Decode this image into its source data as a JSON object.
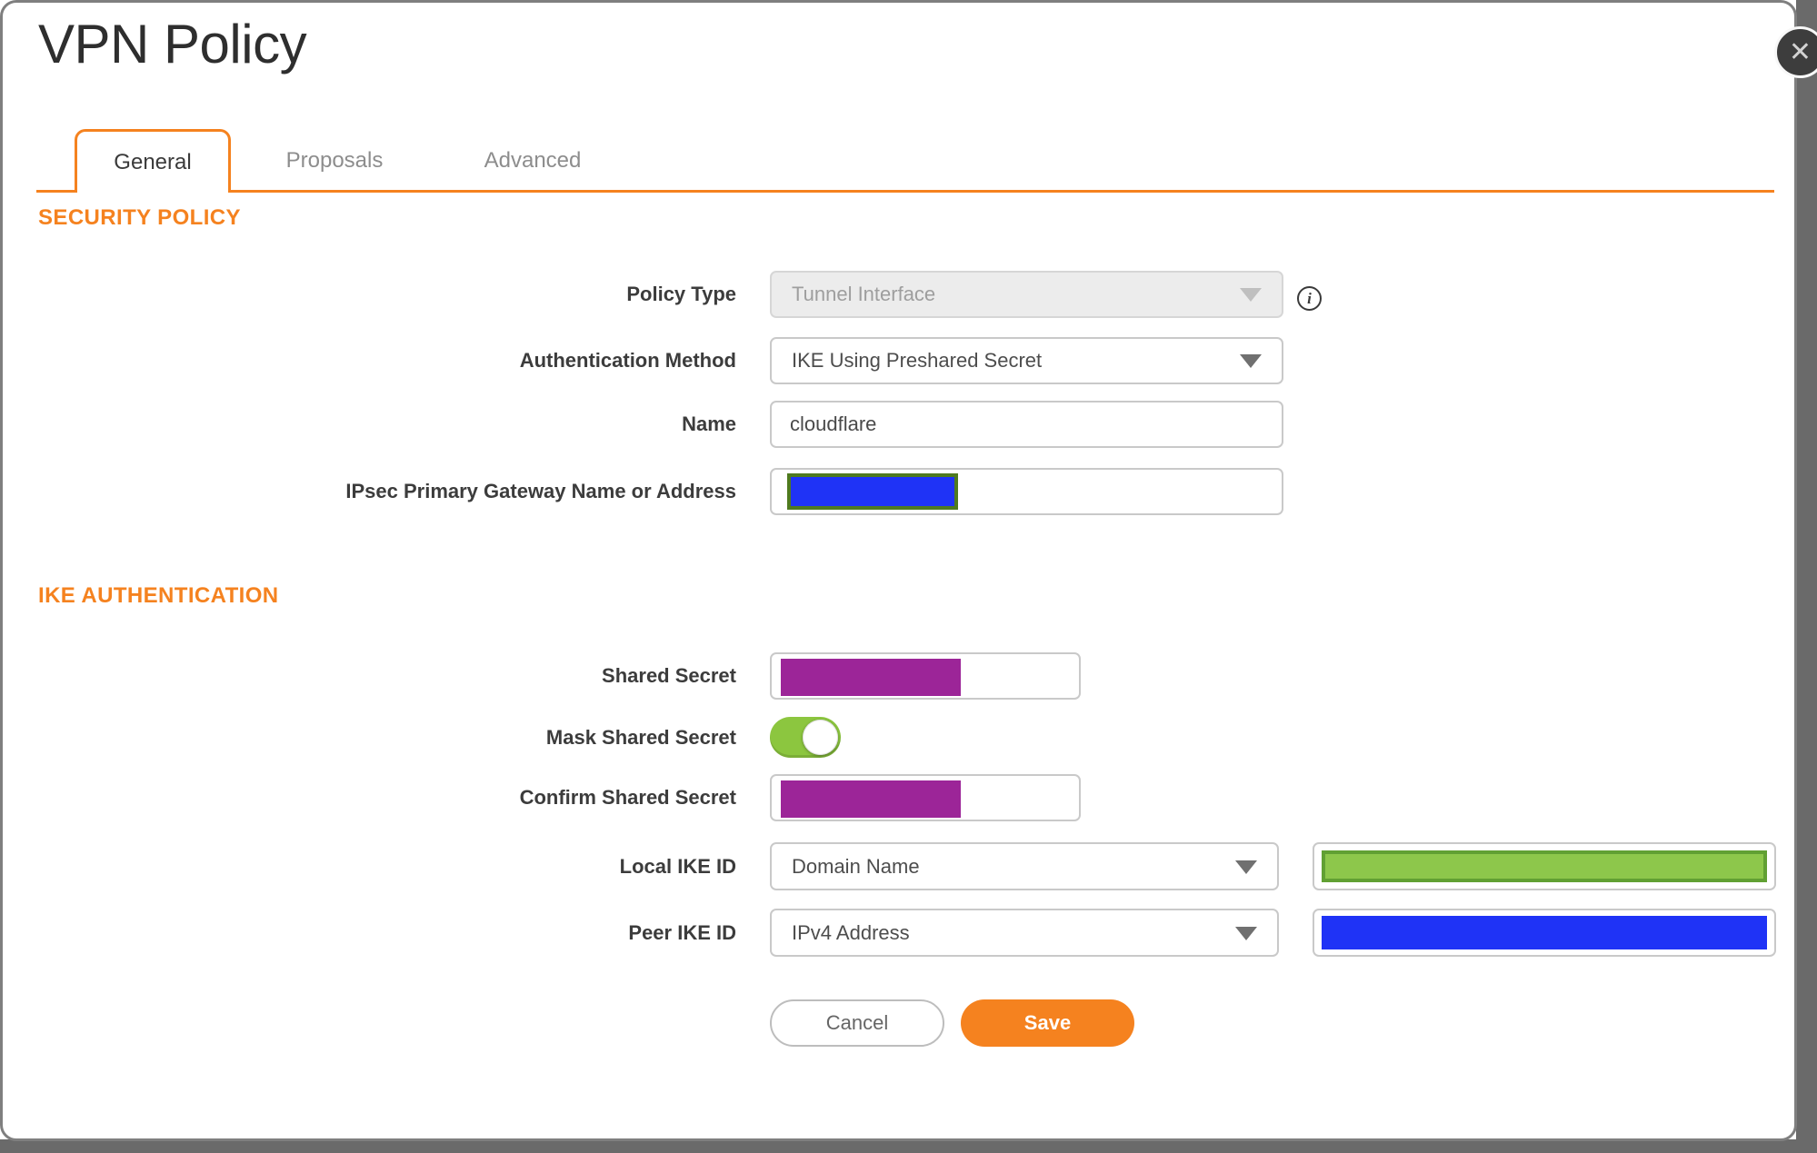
{
  "dialog": {
    "title": "VPN Policy",
    "close_icon": "✕",
    "info_icon": "i"
  },
  "tabs": [
    {
      "label": "General",
      "active": true
    },
    {
      "label": "Proposals",
      "active": false
    },
    {
      "label": "Advanced",
      "active": false
    }
  ],
  "security_policy": {
    "heading": "SECURITY POLICY",
    "policy_type": {
      "label": "Policy Type",
      "value": "Tunnel Interface",
      "disabled": true
    },
    "authentication_method": {
      "label": "Authentication Method",
      "value": "IKE Using Preshared Secret"
    },
    "name": {
      "label": "Name",
      "value": "cloudflare"
    },
    "gateway": {
      "label": "IPsec Primary Gateway Name or Address",
      "value_redacted": true
    }
  },
  "ike_authentication": {
    "heading": "IKE AUTHENTICATION",
    "shared_secret": {
      "label": "Shared Secret",
      "value_redacted": true
    },
    "mask_shared_secret": {
      "label": "Mask Shared Secret",
      "enabled": true
    },
    "confirm_shared_secret": {
      "label": "Confirm Shared Secret",
      "value_redacted": true
    },
    "local_ike_id": {
      "label": "Local IKE ID",
      "value": "Domain Name",
      "id_value_redacted": true
    },
    "peer_ike_id": {
      "label": "Peer IKE ID",
      "value": "IPv4 Address",
      "id_value_redacted": true
    }
  },
  "actions": {
    "cancel": "Cancel",
    "save": "Save"
  },
  "colors": {
    "accent": "#F5821F",
    "edge": "#6A6A6A",
    "redact_purple": "#9C2598",
    "redact_blue": "#1F33F6",
    "redact_green_fill": "#8DC74B",
    "redact_green_border": "#61A033",
    "redact_olive_border": "#4F7A1F",
    "toggle_green": "#8CC63F"
  }
}
